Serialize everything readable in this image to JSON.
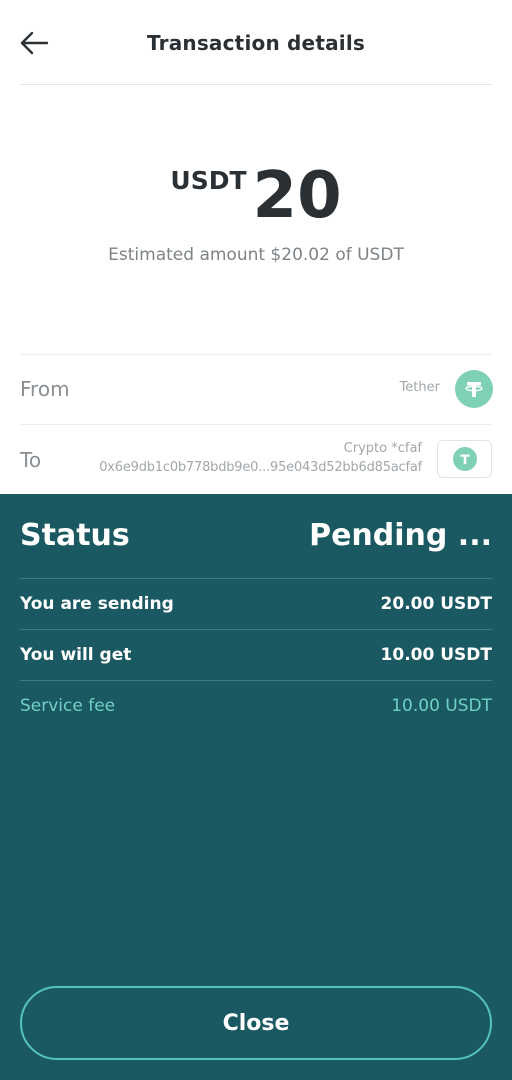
{
  "header": {
    "back_icon": "arrow-left-icon",
    "title": "Transaction details"
  },
  "amount": {
    "currency": "USDT",
    "value": "20",
    "estimate": "Estimated amount $20.02 of USDT"
  },
  "from": {
    "label": "From",
    "name": "Tether",
    "icon": "tether-icon"
  },
  "to": {
    "label": "To",
    "caption": "Crypto *cfaf",
    "address": "0x6e9db1c0b778bdb9e0...95e043d52bb6d85acfaf",
    "icon": "tether-icon"
  },
  "status": {
    "label": "Status",
    "value": "Pending ..."
  },
  "details": {
    "sending_label": "You are sending",
    "sending_value": "20.00 USDT",
    "get_label": "You will get",
    "get_value": "10.00 USDT",
    "fee_label": "Service fee",
    "fee_value": "10.00 USDT"
  },
  "close_label": "Close",
  "colors": {
    "panel": "#1b5962",
    "accent": "#6fd0c3",
    "tether": "#7fd1b3"
  }
}
